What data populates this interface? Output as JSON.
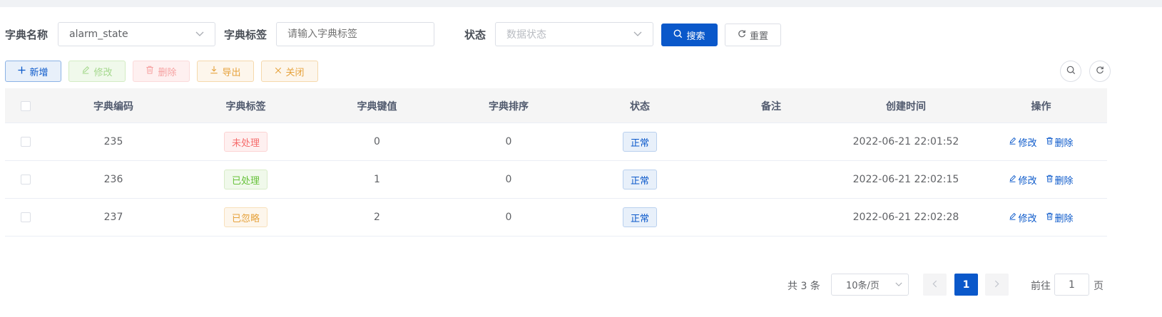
{
  "search": {
    "dict_name_label": "字典名称",
    "dict_name_value": "alarm_state",
    "dict_label_label": "字典标签",
    "dict_label_placeholder": "请输入字典标签",
    "status_label": "状态",
    "status_placeholder": "数据状态",
    "search_button": "搜索",
    "reset_button": "重置"
  },
  "toolbar": {
    "add": "新增",
    "edit": "修改",
    "delete": "删除",
    "export": "导出",
    "close": "关闭"
  },
  "table": {
    "headers": [
      "字典编码",
      "字典标签",
      "字典键值",
      "字典排序",
      "状态",
      "备注",
      "创建时间",
      "操作"
    ],
    "rows": [
      {
        "code": "235",
        "label": "未处理",
        "label_color": "red",
        "value": "0",
        "sort": "0",
        "status": "正常",
        "remark": "",
        "created": "2022-06-21 22:01:52"
      },
      {
        "code": "236",
        "label": "已处理",
        "label_color": "green",
        "value": "1",
        "sort": "0",
        "status": "正常",
        "remark": "",
        "created": "2022-06-21 22:02:15"
      },
      {
        "code": "237",
        "label": "已忽略",
        "label_color": "orange",
        "value": "2",
        "sort": "0",
        "status": "正常",
        "remark": "",
        "created": "2022-06-21 22:02:28"
      }
    ],
    "row_actions": {
      "edit": "修改",
      "delete": "删除"
    }
  },
  "pagination": {
    "total": "共 3 条",
    "page_size": "10条/页",
    "current_page": "1",
    "goto_prefix": "前往",
    "goto_value": "1",
    "goto_suffix": "页"
  },
  "colors": {
    "primary": "#0a58ca",
    "success": "#67c23a",
    "danger": "#f56c6c",
    "warning": "#e6a23c"
  },
  "icons": [
    "search-icon",
    "refresh-icon",
    "plus-icon",
    "edit-icon",
    "delete-icon",
    "download-icon",
    "close-icon",
    "chevron-down-icon",
    "chevron-left-icon",
    "chevron-right-icon"
  ]
}
